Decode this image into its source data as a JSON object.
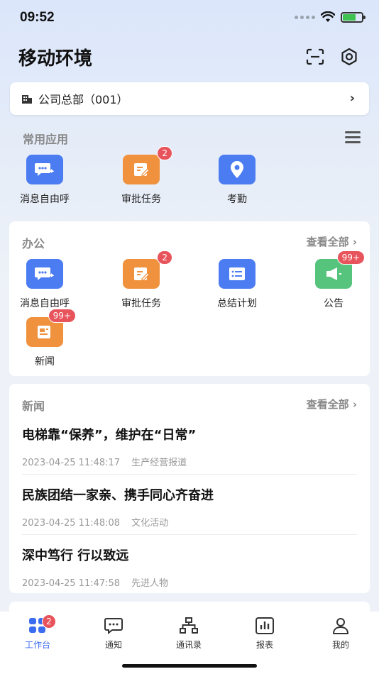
{
  "status": {
    "time": "09:52"
  },
  "header": {
    "title": "移动环境"
  },
  "org": {
    "label": "公司总部（001）"
  },
  "common": {
    "title": "常用应用",
    "items": [
      {
        "label": "消息自由呼",
        "color": "#4b7cf2",
        "icon": "chat-forward-icon",
        "badge": ""
      },
      {
        "label": "审批任务",
        "color": "#f0913d",
        "icon": "edit-doc-icon",
        "badge": "2"
      },
      {
        "label": "考勤",
        "color": "#4b7cf2",
        "icon": "location-pin-icon",
        "badge": ""
      }
    ]
  },
  "office": {
    "title": "办公",
    "view_all": "查看全部",
    "items": [
      {
        "label": "消息自由呼",
        "color": "#4b7cf2",
        "icon": "chat-forward-icon",
        "badge": ""
      },
      {
        "label": "审批任务",
        "color": "#f0913d",
        "icon": "edit-doc-icon",
        "badge": "2"
      },
      {
        "label": "总结计划",
        "color": "#4b7cf2",
        "icon": "list-icon",
        "badge": ""
      },
      {
        "label": "公告",
        "color": "#57c47e",
        "icon": "megaphone-icon",
        "badge": "99+"
      },
      {
        "label": "新闻",
        "color": "#f0913d",
        "icon": "newspaper-icon",
        "badge": "99+"
      }
    ]
  },
  "news": {
    "title": "新闻",
    "view_all": "查看全部",
    "items": [
      {
        "title": "电梯靠“保养”，维护在“日常”",
        "time": "2023-04-25 11:48:17",
        "category": "生产经营报道"
      },
      {
        "title": "民族团结一家亲、携手同心齐奋进",
        "time": "2023-04-25 11:48:08",
        "category": "文化活动"
      },
      {
        "title": "深中笃行 行以致远",
        "time": "2023-04-25 11:47:58",
        "category": "先进人物"
      }
    ]
  },
  "tabs": [
    {
      "label": "工作台",
      "icon": "grid-icon",
      "badge": "2",
      "active": true
    },
    {
      "label": "通知",
      "icon": "message-icon",
      "badge": ""
    },
    {
      "label": "通讯录",
      "icon": "org-chart-icon",
      "badge": ""
    },
    {
      "label": "报表",
      "icon": "bar-chart-icon",
      "badge": ""
    },
    {
      "label": "我的",
      "icon": "user-icon",
      "badge": ""
    }
  ],
  "colors": {
    "accent": "#3b6df0",
    "badge": "#e8545c"
  }
}
